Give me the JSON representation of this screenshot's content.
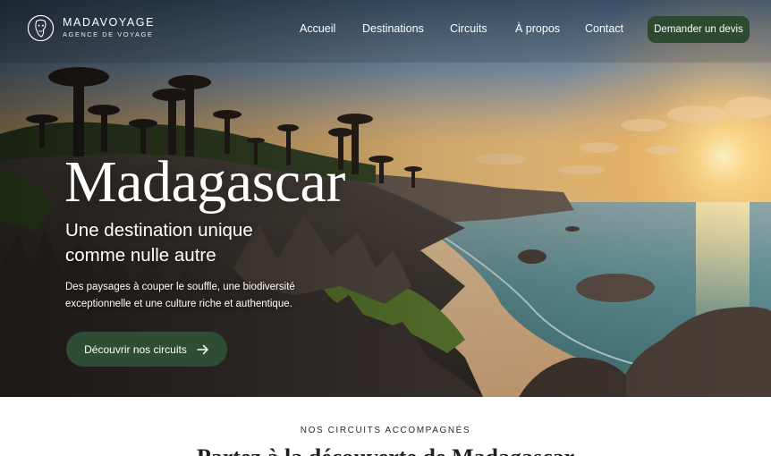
{
  "brand": {
    "name": "MADAVOYAGE",
    "tagline": "AGENCE DE VOYAGE",
    "logo_icon": "mask-face-icon"
  },
  "nav": {
    "items": [
      {
        "label": "Accueil"
      },
      {
        "label": "Destinations"
      },
      {
        "label": "Circuits"
      },
      {
        "label": "À propos"
      },
      {
        "label": "Contact"
      }
    ],
    "cta_label": "Demander un devis"
  },
  "hero": {
    "title": "Madagascar",
    "subtitle": "Une destination unique comme nulle autre",
    "description": "Des paysages à couper le souffle, une biodiversité exceptionnelle et une culture riche et authentique.",
    "cta_label": "Découvrir nos circuits",
    "cta_icon": "arrow-right-icon",
    "background": "baobab-coastline-sunset-photo"
  },
  "section": {
    "kicker": "NOS CIRCUITS ACCOMPAGNÉS",
    "heading": "Partez à la découverte de Madagascar"
  },
  "colors": {
    "primary_green": "#2f4d34",
    "header_button": "#2d4a30",
    "text_light": "#ffffff",
    "text_dark": "#1f1f1f"
  }
}
